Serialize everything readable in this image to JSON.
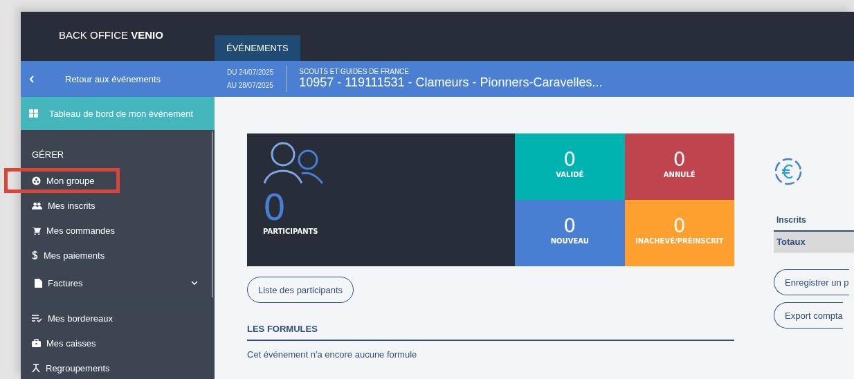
{
  "header": {
    "brand_prefix": "BACK OFFICE",
    "brand_name": "VENIO",
    "tabs": [
      {
        "label": "ÉVÉNEMENTS",
        "selected": true
      }
    ]
  },
  "event_bar": {
    "back_label": "Retour aux événements",
    "date_from": "DU 24/07/2025",
    "date_to": "AU 28/07/2025",
    "organization": "SCOUTS ET GUIDES DE FRANCE",
    "title": "10957 - 119111531 - Clameurs - Pionners-Caravelles..."
  },
  "sidebar": {
    "dashboard": {
      "label": "Tableau de bord de mon événement",
      "selected": true
    },
    "section": "GÉRER",
    "items": [
      {
        "label": "Mon groupe",
        "highlighted": true,
        "expandable": false
      },
      {
        "label": "Mes inscrits",
        "highlighted": false,
        "expandable": false
      },
      {
        "label": "Mes commandes",
        "highlighted": false,
        "expandable": false
      },
      {
        "label": "Mes paiements",
        "highlighted": false,
        "expandable": false
      },
      {
        "label": "Factures",
        "highlighted": false,
        "expandable": true
      }
    ],
    "items_after_divider": [
      {
        "label": "Mes bordereaux",
        "highlighted": false,
        "expandable": false
      },
      {
        "label": "Mes caisses",
        "highlighted": false,
        "expandable": false
      },
      {
        "label": "Regroupements",
        "highlighted": false,
        "expandable": false
      }
    ]
  },
  "stats": {
    "total": {
      "value": "0",
      "label": "PARTICIPANTS"
    },
    "tiles": [
      {
        "value": "0",
        "label": "VALIDÉ",
        "color": "#00b3b0"
      },
      {
        "value": "0",
        "label": "ANNULÉ",
        "color": "#bf444d"
      },
      {
        "value": "0",
        "label": "NOUVEAU",
        "color": "#487fd2"
      },
      {
        "value": "0",
        "label": "INACHEVÉ/PRÉINSCRIT",
        "color": "#fea02f"
      }
    ]
  },
  "participants_button": "Liste des participants",
  "formulas": {
    "title": "LES FORMULES",
    "empty_text": "Cet événement n'a encore aucune formule"
  },
  "payments": {
    "table_header": "Inscrits",
    "total_row": "Totaux",
    "buttons": [
      "Enregistrer un p",
      "Export compta"
    ]
  }
}
